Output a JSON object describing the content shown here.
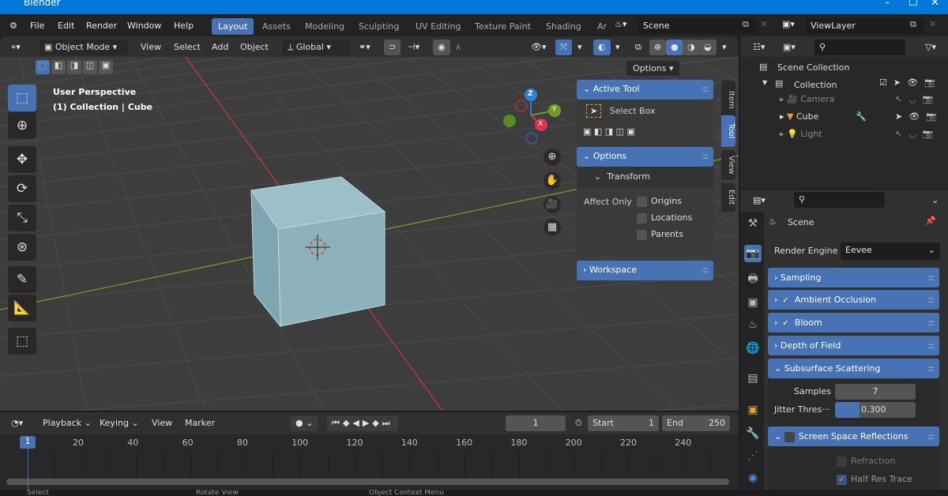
{
  "window": {
    "title": "Blender",
    "controls": [
      "–",
      "☐",
      "✕"
    ]
  },
  "menu": {
    "items": [
      "File",
      "Edit",
      "Render",
      "Window",
      "Help"
    ],
    "workspaces": [
      "Layout",
      "Assets",
      "Modeling",
      "Sculpting",
      "UV Editing",
      "Texture Paint",
      "Shading",
      "Ar"
    ],
    "active_workspace": "Layout",
    "scene": "Scene",
    "view_layer": "ViewLayer"
  },
  "viewport_header": {
    "mode": "Object Mode",
    "menus": [
      "View",
      "Select",
      "Add",
      "Object"
    ],
    "orientation": "Global",
    "options": "Options"
  },
  "viewport": {
    "perspective": "User Perspective",
    "context": "(1) Collection | Cube",
    "gizmo": {
      "z": "Z",
      "y": "Y",
      "x": "X"
    }
  },
  "npanel": {
    "tabs": [
      "Item",
      "Tool",
      "View",
      "Edit"
    ],
    "active_tab": "Tool",
    "active_tool_header": "Active Tool",
    "tool_name": "Select Box",
    "options_header": "Options",
    "transform": "Transform",
    "affect_only": "Affect Only",
    "checkboxes": [
      {
        "label": "Origins",
        "checked": false
      },
      {
        "label": "Locations",
        "checked": false
      },
      {
        "label": "Parents",
        "checked": false
      }
    ],
    "workspace": "Workspace"
  },
  "outliner": {
    "root": "Scene Collection",
    "collection": "Collection",
    "items": [
      {
        "name": "Camera"
      },
      {
        "name": "Cube"
      },
      {
        "name": "Light"
      }
    ]
  },
  "properties": {
    "context": "Scene",
    "render_engine_label": "Render Engine",
    "render_engine": "Eevee",
    "sections": [
      {
        "label": "Sampling"
      },
      {
        "label": "Ambient Occlusion",
        "checked": true
      },
      {
        "label": "Bloom",
        "checked": true
      },
      {
        "label": "Depth of Field"
      },
      {
        "label": "Subsurface Scattering"
      },
      {
        "label": "Screen Space Reflections",
        "checked": false
      }
    ],
    "samples_label": "Samples",
    "samples": "7",
    "jitter_label": "Jitter Thres···",
    "jitter": "0.300",
    "jitter_fill": 0.3,
    "refraction": "Refraction",
    "half_res": "Half Res Trace"
  },
  "timeline": {
    "menus": [
      "Playback",
      "Keying",
      "View",
      "Marker"
    ],
    "current_frame": "1",
    "start_label": "Start",
    "start": "1",
    "end_label": "End",
    "end": "250",
    "ticks": [
      "20",
      "40",
      "60",
      "80",
      "100",
      "120",
      "140",
      "160",
      "180",
      "200",
      "220",
      "240"
    ]
  },
  "status": {
    "items": [
      "Select",
      "Rotate View",
      "Object Context Menu"
    ]
  },
  "colors": {
    "accent": "#4772b3",
    "titlebar": "#0078d7",
    "x_axis": "#c9353c",
    "y_axis": "#6e9c25",
    "cube": "#8fb3bd"
  }
}
